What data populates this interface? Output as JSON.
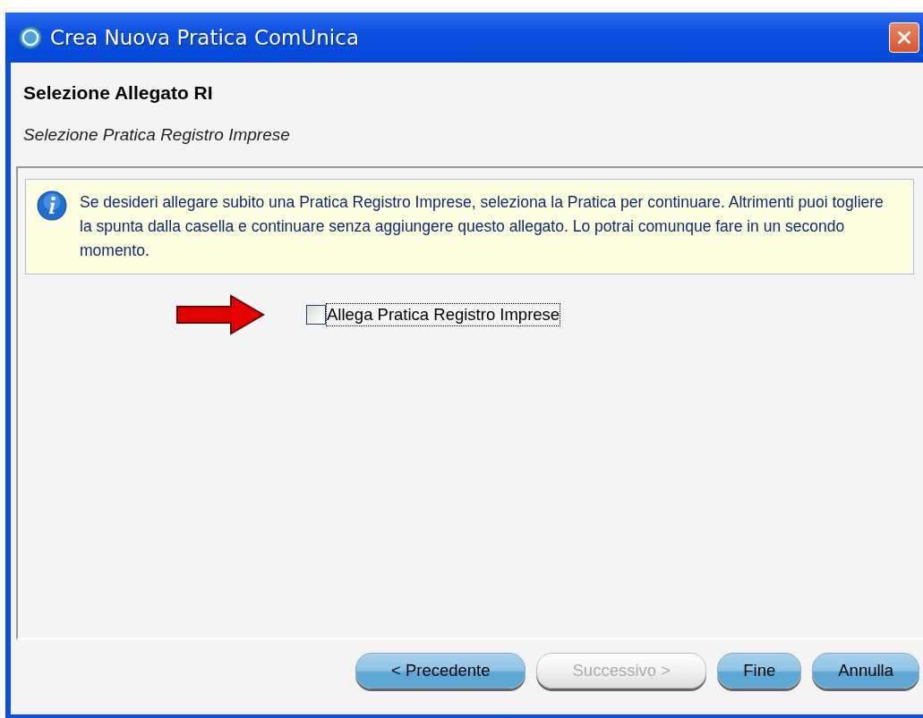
{
  "window": {
    "title": "Crea Nuova Pratica ComUnica"
  },
  "header": {
    "title": "Selezione Allegato RI",
    "subtitle": "Selezione Pratica Registro Imprese"
  },
  "info": {
    "text": "Se desideri allegare subito una Pratica Registro Imprese, seleziona la Pratica per continuare. Altrimenti puoi togliere la spunta dalla casella e continuare senza aggiungere questo allegato. Lo potrai comunque fare in un secondo momento."
  },
  "checkbox": {
    "label": "Allega Pratica Registro Imprese",
    "checked": false,
    "focused": true
  },
  "buttons": [
    {
      "label": "< Precedente",
      "disabled": false
    },
    {
      "label": "Successivo >",
      "disabled": true
    },
    {
      "label": "Fine",
      "disabled": false
    },
    {
      "label": "Annulla",
      "disabled": false
    }
  ]
}
